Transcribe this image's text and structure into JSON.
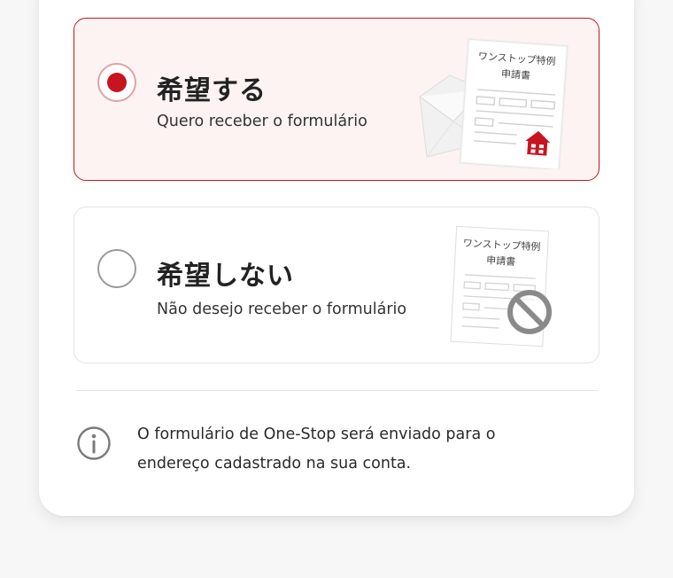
{
  "options": [
    {
      "title": "希望する",
      "subtitle": "Quero receber o formulário",
      "selected": true,
      "doc_title_line1": "ワンストップ特例",
      "doc_title_line2": "申請書",
      "illustration_icon": "house-icon"
    },
    {
      "title": "希望しない",
      "subtitle": "Não desejo receber o formulário",
      "selected": false,
      "doc_title_line1": "ワンストップ特例",
      "doc_title_line2": "申請書",
      "illustration_icon": "prohibited-icon"
    }
  ],
  "info": {
    "text": "O formulário de One-Stop será enviado para o endereço cadastrado na sua conta.",
    "icon": "info-icon"
  },
  "colors": {
    "accent": "#c8141e",
    "selected_bg": "#fdf3f3",
    "border_gray": "#e3e3e3"
  }
}
